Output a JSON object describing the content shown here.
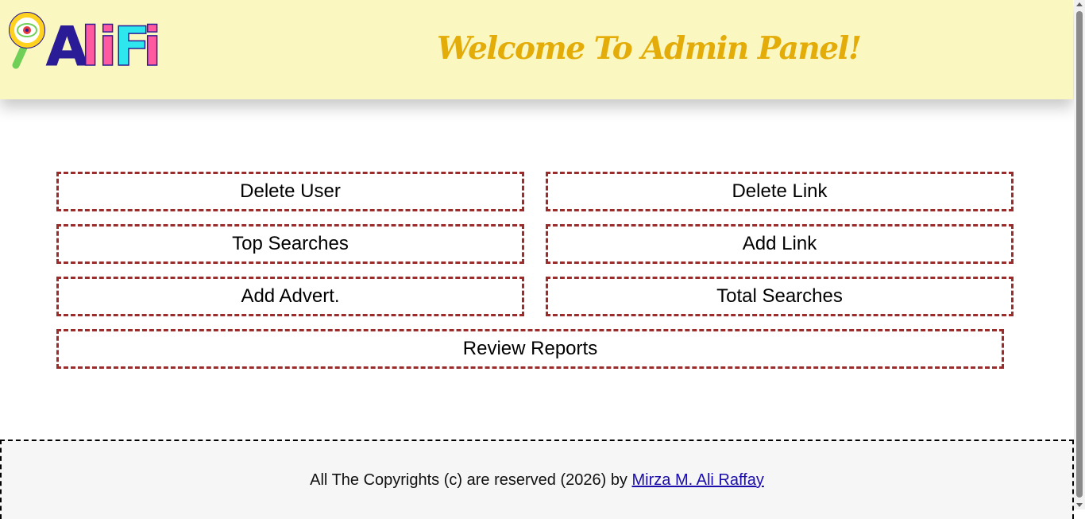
{
  "header": {
    "logo": {
      "icon": "magnifier-eye-icon",
      "letters": [
        "A",
        "l",
        "i",
        "F",
        "i"
      ],
      "colors": {
        "A": "#2a1b96",
        "l": "#ff5aa0",
        "i1": "#ff5aa0",
        "F": "#2ee6ee",
        "i2": "#ff5aa0",
        "glass_ring": "#ffd21f",
        "glass_handle": "#6fcf56",
        "eye_iris": "#e83a3a",
        "outline": "#2a1b96"
      }
    },
    "welcome": "Welcome To Admin Panel!"
  },
  "actions": {
    "delete_user": "Delete User",
    "delete_link": "Delete Link",
    "top_searches": "Top Searches",
    "add_link": "Add Link",
    "add_advert": "Add Advert.",
    "total_searches": "Total Searches",
    "review_reports": "Review Reports"
  },
  "footer": {
    "text": "All The Copyrights (c) are reserved (2026) by",
    "link": "Mirza M. Ali Raffay"
  },
  "colors": {
    "header_bg": "#fbf7c0",
    "welcome": "#e3ac08",
    "button_border": "#9b2c2c",
    "footer_bg": "#f6f6f6",
    "link": "#1a0dab"
  }
}
